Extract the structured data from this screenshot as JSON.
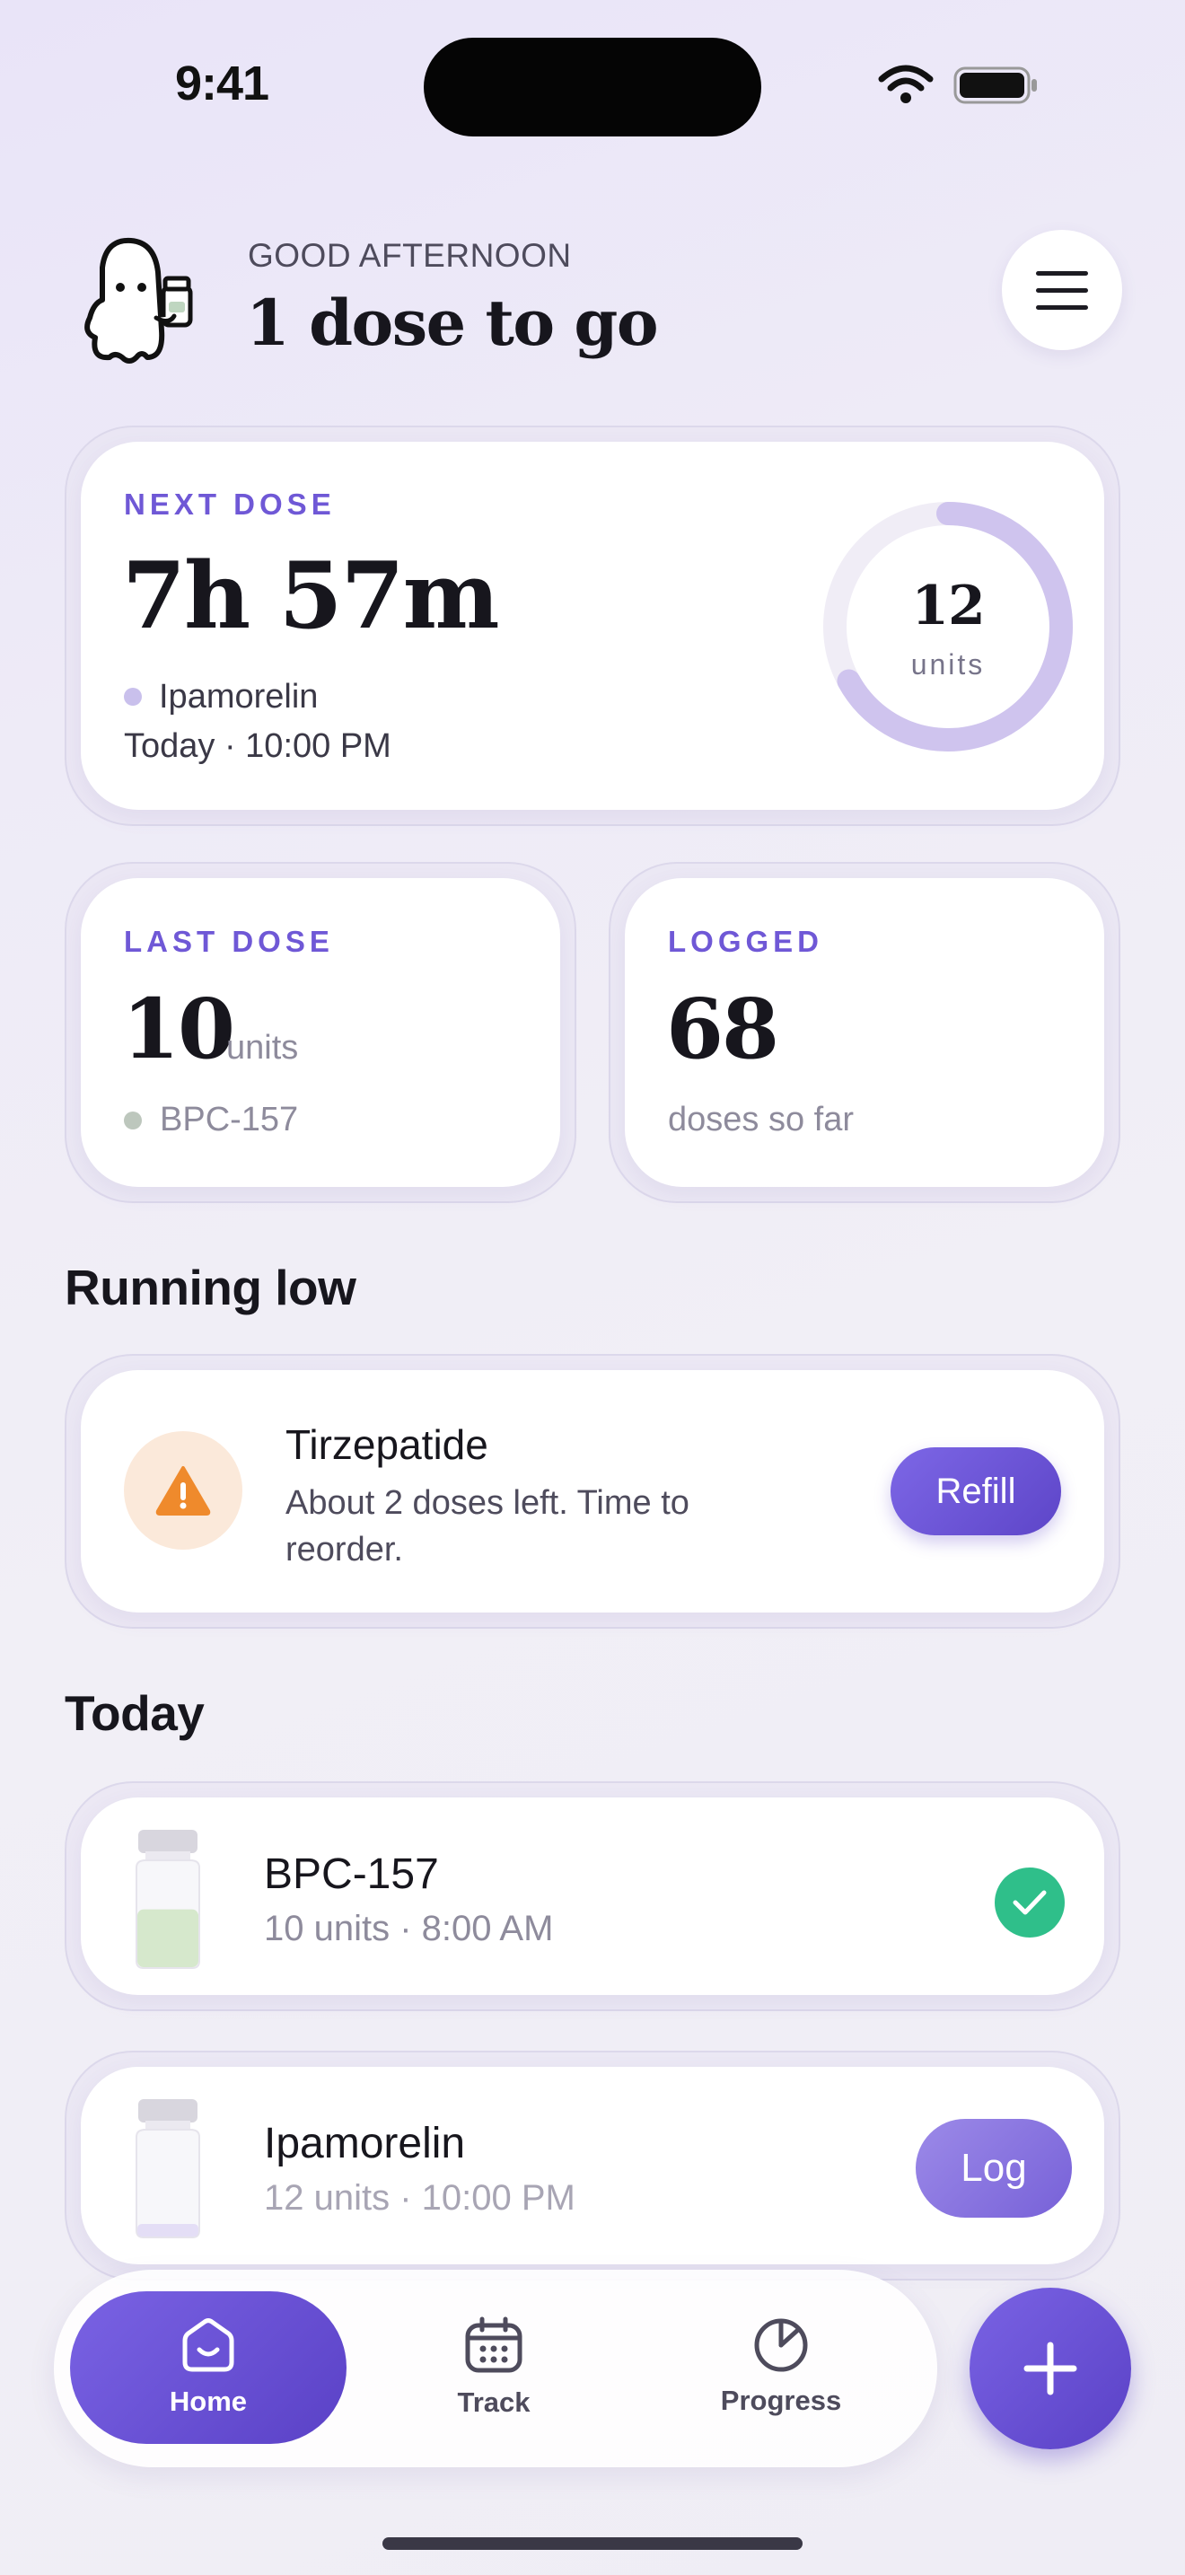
{
  "status_bar": {
    "time": "9:41"
  },
  "header": {
    "greeting": "GOOD AFTERNOON",
    "headline": "1 dose to go",
    "menu_icon": "hamburger-menu-icon",
    "mascot_icon": "ghost-mascot-holding-vial-icon"
  },
  "next_dose": {
    "kicker": "NEXT DOSE",
    "countdown": "7h 57m",
    "medication": "Ipamorelin",
    "when": "Today · 10:00 PM",
    "amount": "12",
    "unit": "units",
    "countdown_progress": 0.67
  },
  "last_dose": {
    "kicker": "LAST DOSE",
    "amount": "10",
    "unit": "units",
    "medication": "BPC-157"
  },
  "logged": {
    "kicker": "LOGGED",
    "count": "68",
    "subtitle": "doses so far"
  },
  "running_low": {
    "title": "Running low",
    "item": {
      "name": "Tirzepatide",
      "description": "About 2 doses left. Time to reorder.",
      "button": "Refill",
      "icon": "warning-triangle-icon"
    }
  },
  "today": {
    "title": "Today",
    "doses": [
      {
        "name": "BPC-157",
        "meta": "10 units · 8:00 AM",
        "status": "done",
        "fill_level": 0.55,
        "fill_color": "#d6e8cc"
      },
      {
        "name": "Ipamorelin",
        "meta": "12 units · 10:00 PM",
        "status": "pending",
        "action": "Log",
        "fill_level": 0.12,
        "fill_color": "#e4def6"
      }
    ]
  },
  "tabbar": {
    "tabs": [
      {
        "label": "Home",
        "icon": "home-icon",
        "active": true
      },
      {
        "label": "Track",
        "icon": "calendar-icon",
        "active": false
      },
      {
        "label": "Progress",
        "icon": "pie-chart-icon",
        "active": false
      }
    ],
    "fab_icon": "plus-icon"
  },
  "colors": {
    "accent": "#6f58d6",
    "success": "#2fbf8a",
    "warning": "#ef8a2c",
    "ring_track": "#f0edf6",
    "ring_fill": "#cfc4ee"
  }
}
